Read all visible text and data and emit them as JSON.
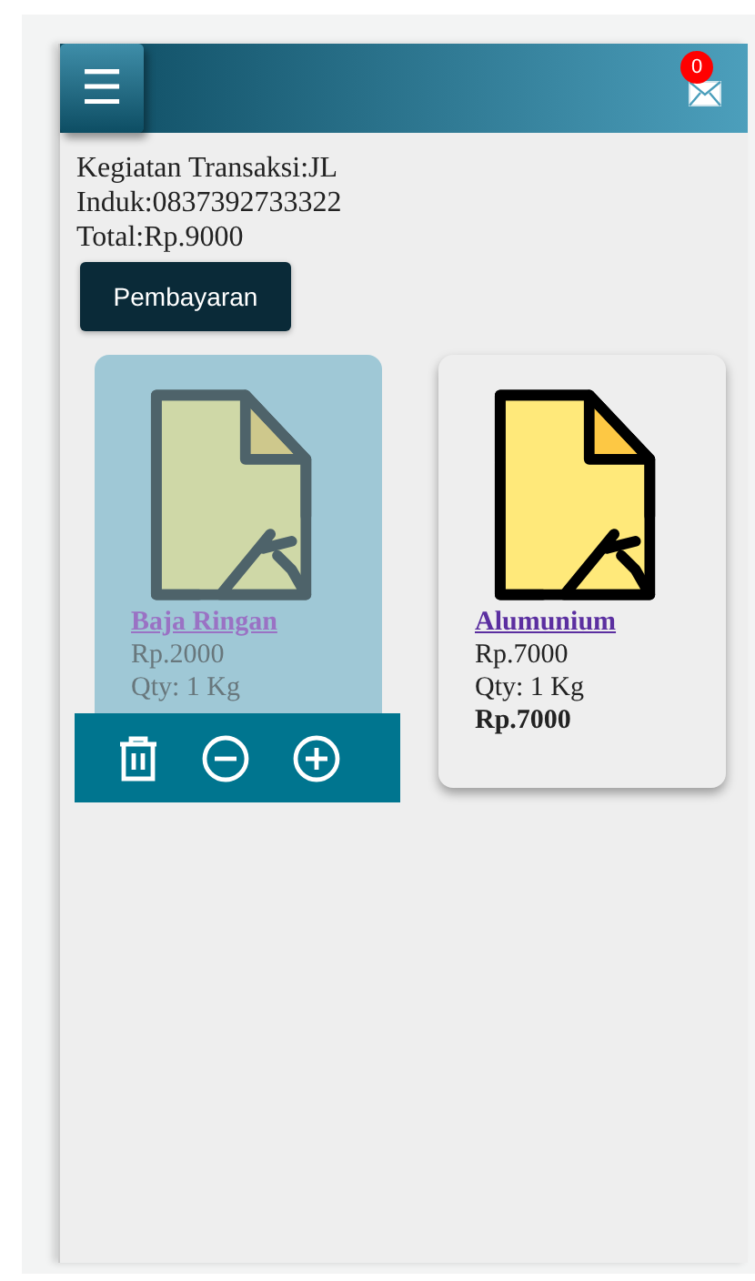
{
  "header": {
    "menu_icon": "☰",
    "notification_count": "0"
  },
  "info": [
    "Kegiatan Transaksi:JL",
    "Induk:0837392733322",
    "Total:Rp.9000"
  ],
  "pay_button": "Pembayaran",
  "products": [
    {
      "name": "Baja Ringan",
      "price": "Rp.2000",
      "qty": "Qty: 1 Kg",
      "selected": true
    },
    {
      "name": "Alumunium",
      "price": "Rp.7000",
      "qty": "Qty: 1 Kg",
      "subtotal": "Rp.7000",
      "selected": false
    }
  ]
}
